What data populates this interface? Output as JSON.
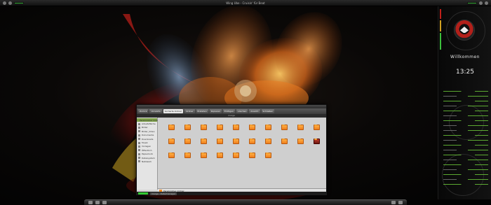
{
  "top_panel": {
    "title": "Wing Ube - Cruisin' für Beat"
  },
  "conky": {
    "greeting": "Willkommen",
    "time": "13:25"
  },
  "file_manager": {
    "toolbar": [
      {
        "label": "Zurück"
      },
      {
        "label": "Vorwärts"
      },
      {
        "label": "Sortierte Ordner",
        "active": true
      },
      {
        "label": "Ordner"
      },
      {
        "label": "Erstellen"
      },
      {
        "label": "Kopieren"
      },
      {
        "label": "Einfügen"
      },
      {
        "label": "Löschen"
      },
      {
        "label": "Ansicht"
      },
      {
        "label": "Schließen"
      }
    ],
    "path": "marga",
    "sidebar": [
      {
        "label": "Persönlicher Ordner",
        "selected": true
      },
      {
        "label": "Arbeitsfläche"
      },
      {
        "label": "Bilder"
      },
      {
        "label": "Bilder_Video"
      },
      {
        "label": "Dokumente"
      },
      {
        "label": "Downloads"
      },
      {
        "label": "Musik"
      },
      {
        "label": "Vorlagen"
      },
      {
        "label": "Öffentlich"
      },
      {
        "label": "Papierkorb"
      },
      {
        "label": "Dateisystem"
      },
      {
        "label": "Netzwerk"
      }
    ],
    "status": "Persönlicher Ordner",
    "colors": {
      "folder": "#f08a20",
      "selection": "#7fa14a"
    }
  },
  "taskbar": {
    "items": [
      "marga - Dateimanager"
    ]
  }
}
